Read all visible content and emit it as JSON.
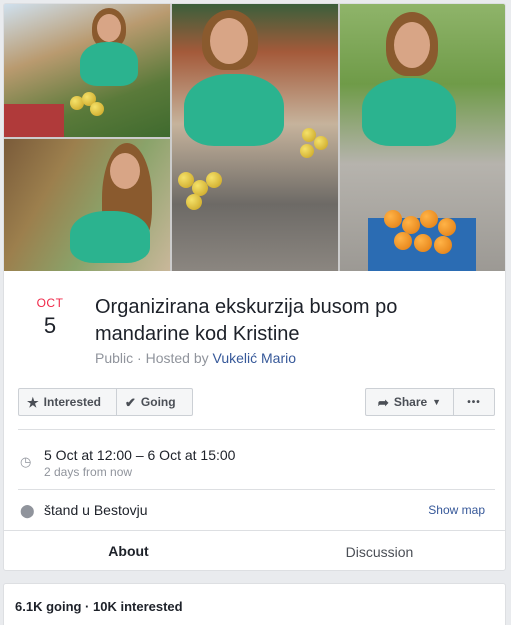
{
  "event": {
    "month": "OCT",
    "day": "5",
    "title": "Organizirana ekskurzija busom po mandarine kod Kristine",
    "privacy": "Public",
    "hosted_by_prefix": "· Hosted by",
    "host": "Vukelić Mario"
  },
  "actions": {
    "interested_label": "Interested",
    "going_label": "Going",
    "share_label": "Share",
    "more_label": "•••"
  },
  "details": {
    "time": "5 Oct at 12:00 – 6 Oct at 15:00",
    "time_relative": "2 days from now",
    "location": "štand u Bestovju",
    "show_map_label": "Show map"
  },
  "tabs": [
    {
      "label": "About",
      "active": true
    },
    {
      "label": "Discussion",
      "active": false
    }
  ],
  "stats": {
    "summary": "6.1K going · 10K interested"
  },
  "colors": {
    "accent": "#4267b2",
    "month": "#f02849",
    "link": "#365899"
  }
}
